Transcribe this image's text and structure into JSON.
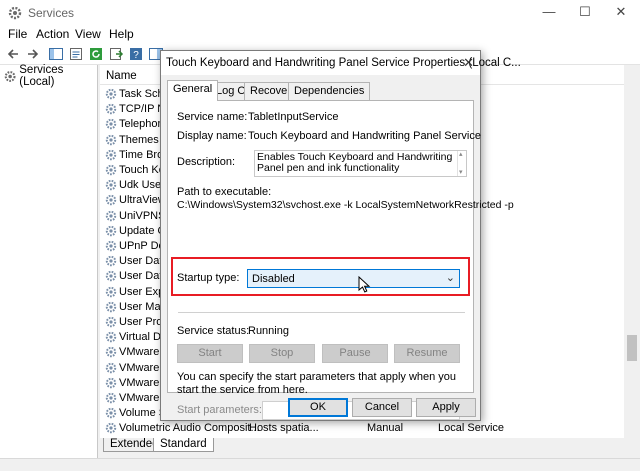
{
  "window": {
    "title": "Services",
    "controls": {
      "minimize": "—",
      "maximize": "☐",
      "close": "✕"
    }
  },
  "menu": [
    "File",
    "Action",
    "View",
    "Help"
  ],
  "toolbar": {
    "icons": [
      "back-icon",
      "forward-icon",
      "show-hide-tree-icon",
      "properties-icon",
      "refresh-icon",
      "export-icon",
      "help-icon",
      "properties-pane-icon"
    ]
  },
  "tree": {
    "root": "Services (Local)"
  },
  "list": {
    "column_name": "Name",
    "rows": [
      {
        "name": "Task Scheduler",
        "visible_name": "Task Sche"
      },
      {
        "name": "TCP/IP NetBIOS Helper",
        "visible_name": "TCP/IP Ne"
      },
      {
        "name": "Telephony",
        "visible_name": "Telephony"
      },
      {
        "name": "Themes",
        "visible_name": "Themes"
      },
      {
        "name": "Time Broker",
        "visible_name": "Time Brok"
      },
      {
        "name": "Touch Keyboard and Handwriting Panel Service",
        "visible_name": "Touch Key"
      },
      {
        "name": "Udk User Service",
        "visible_name": "Udk User"
      },
      {
        "name": "UltraViewer",
        "visible_name": "UltraView"
      },
      {
        "name": "UniVPNService",
        "visible_name": "UniVPNSe"
      },
      {
        "name": "Update Orchestrator Service",
        "visible_name": "Update O"
      },
      {
        "name": "UPnP Device Host",
        "visible_name": "UPnP Dev"
      },
      {
        "name": "User Data Access",
        "visible_name": "User Data"
      },
      {
        "name": "User Data Storage",
        "visible_name": "User Data"
      },
      {
        "name": "User Experience",
        "visible_name": "User Expe"
      },
      {
        "name": "User Manager",
        "visible_name": "User Man"
      },
      {
        "name": "User Profile Service",
        "visible_name": "User Profi"
      },
      {
        "name": "Virtual Disk",
        "visible_name": "Virtual Dis"
      },
      {
        "name": "VMware Authorization",
        "visible_name": "VMware A"
      },
      {
        "name": "VMware DHCP",
        "visible_name": "VMware D"
      },
      {
        "name": "VMware NAT",
        "visible_name": "VMware N"
      },
      {
        "name": "VMware USB",
        "visible_name": "VMware U"
      },
      {
        "name": "Volume Shadow Copy",
        "visible_name": "Volume Sh"
      },
      {
        "name": "Volumetric Audio Compositor",
        "visible_name": "Volumetric Audio Composit...",
        "description": "Hosts spatia...",
        "startup": "Manual",
        "logon": "Local Service"
      }
    ]
  },
  "bottom_tabs": [
    "Extended",
    "Standard"
  ],
  "dialog": {
    "title": "Touch Keyboard and Handwriting Panel Service Properties (Local C...",
    "close": "✕",
    "tabs": [
      "General",
      "Log On",
      "Recovery",
      "Dependencies"
    ],
    "active_tab": "General",
    "service_name_label": "Service name:",
    "service_name": "TabletInputService",
    "display_name_label": "Display name:",
    "display_name": "Touch Keyboard and Handwriting Panel Service",
    "description_label": "Description:",
    "description": "Enables Touch Keyboard and Handwriting Panel pen and ink functionality",
    "path_label": "Path to executable:",
    "path": "C:\\Windows\\System32\\svchost.exe -k LocalSystemNetworkRestricted -p",
    "startup_type_label": "Startup type:",
    "startup_type": "Disabled",
    "startup_arrow": "⌄",
    "highlight_color": "#e81c24",
    "service_status_label": "Service status:",
    "service_status": "Running",
    "buttons": {
      "start": "Start",
      "stop": "Stop",
      "pause": "Pause",
      "resume": "Resume"
    },
    "help_text": "You can specify the start parameters that apply when you start the service from here.",
    "start_params_label": "Start parameters:",
    "start_params_value": "",
    "ok": "OK",
    "cancel": "Cancel",
    "apply": "Apply"
  }
}
